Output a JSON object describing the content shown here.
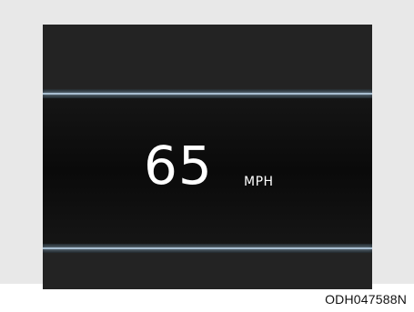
{
  "display": {
    "speed_value": "65",
    "speed_unit": "MPH"
  },
  "figure": {
    "code": "ODH047588N"
  },
  "colors": {
    "frame_background": "#e8e8e8",
    "screen_background": "#232323",
    "center_panel": "#0a0a0a",
    "accent_line": "#a8bed0",
    "text": "#ffffff"
  }
}
